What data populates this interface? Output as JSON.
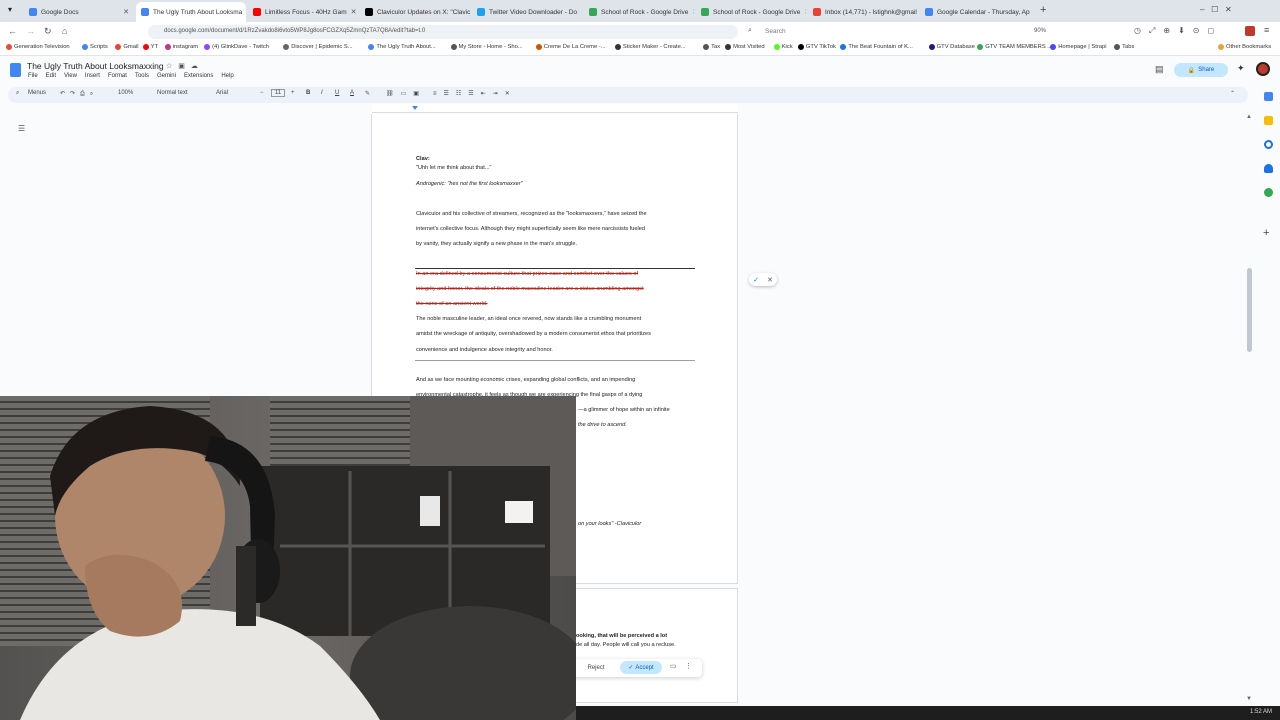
{
  "tabs": [
    {
      "label": "Google Docs",
      "color": "#4285f4"
    },
    {
      "label": "The Ugly Truth About Looksma",
      "color": "#4285f4",
      "active": true
    },
    {
      "label": "Limitless Focus - 40Hz Gam",
      "color": "#ff0000"
    },
    {
      "label": "Claviculor Updates on X: \"Clavic",
      "color": "#000000"
    },
    {
      "label": "Twitter Video Downloader - Do",
      "color": "#1da1f2"
    },
    {
      "label": "School of Rock - Google Drive",
      "color": "#34a853"
    },
    {
      "label": "School of Rock - Google Drive",
      "color": "#34a853"
    },
    {
      "label": "Inbox (14,771) - lstighnk@gmail",
      "color": "#ea4335"
    },
    {
      "label": "Google Calendar - Thursday, Ap",
      "color": "#4285f4"
    }
  ],
  "address": {
    "url": "docs.google.com/document/d/1RzZvakdo8i6vto5WP8Jg8osFCGZXq5ZmnQzTA7Q8A/edit?tab=t.0",
    "search_placeholder": "Search",
    "zoom": "90%"
  },
  "bookmarks": [
    "Generation Television",
    "Scripts",
    "Gmail",
    "YT",
    "instagram",
    "(4) GlinkDave - Twitch",
    "Discover | Epidemic S...",
    "The Ugly Truth About...",
    "My Store - Home - Sho...",
    "Creme De La Creme -...",
    "Sticker Maker - Create...",
    "Tax",
    "Most Visited",
    "Kick",
    "GTV TikTok",
    "The Beat Fountain of K...",
    "GTV Database",
    "GTV TEAM MEMBERS ...",
    "Homepage | Strapi",
    "Tabs",
    "Other Bookmarks"
  ],
  "doc": {
    "title": "The Ugly Truth About Looksmaxxing",
    "menus": [
      "File",
      "Edit",
      "View",
      "Insert",
      "Format",
      "Tools",
      "Gemini",
      "Extensions",
      "Help"
    ],
    "share_label": "Share"
  },
  "toolbar": {
    "menus": "Menus",
    "zoom": "100%",
    "style": "Normal text",
    "font": "Arial",
    "size": "11"
  },
  "content": {
    "clav_label": "Clav:",
    "clav_line": "\"Uhh let me think about that...\"",
    "andro_line": "Androgenic: \"hes not the first looksmaxxer\"",
    "para1": [
      "Claviculor and his collective of streamers, recognized as the \"looksmaxxers,\" have seized the",
      "internet's collective focus. Although they might superficially seem like mere narcissists fueled",
      "by vanity, they actually signify a new phase in the man's struggle."
    ],
    "para2_deleted": [
      "In an era defined by a consumerist culture that prizes ease and comfort over the values of",
      "integrity and honor, the ideals of the noble masculine leader are a statue crumbling amongst",
      "the ruins of an ancient world."
    ],
    "para2_inserted": [
      "The noble masculine leader, an ideal once revered, now stands like a crumbling monument",
      "amidst the wreckage of antiquity, overshadowed by a modern consumerist ethos that prioritizes",
      "convenience and indulgence above integrity and honor."
    ],
    "para3": [
      "And as we face mounting economic crises, expanding global conflicts, and an impending",
      "environmental catastrophe, it feels as though we are experiencing the final gasps of a dying",
      "—a glimmer of hope within an infinite",
      "the drive to ascend."
    ],
    "quote_tail": "on your looks\" -Claviculor",
    "page2_line1": "ooking, that will be perceived a lot",
    "page2_line2": "de all day. People will call you a recluse."
  },
  "suggestion_card": {
    "reject": "Reject",
    "accept": "Accept"
  },
  "clock": "1:52 AM"
}
